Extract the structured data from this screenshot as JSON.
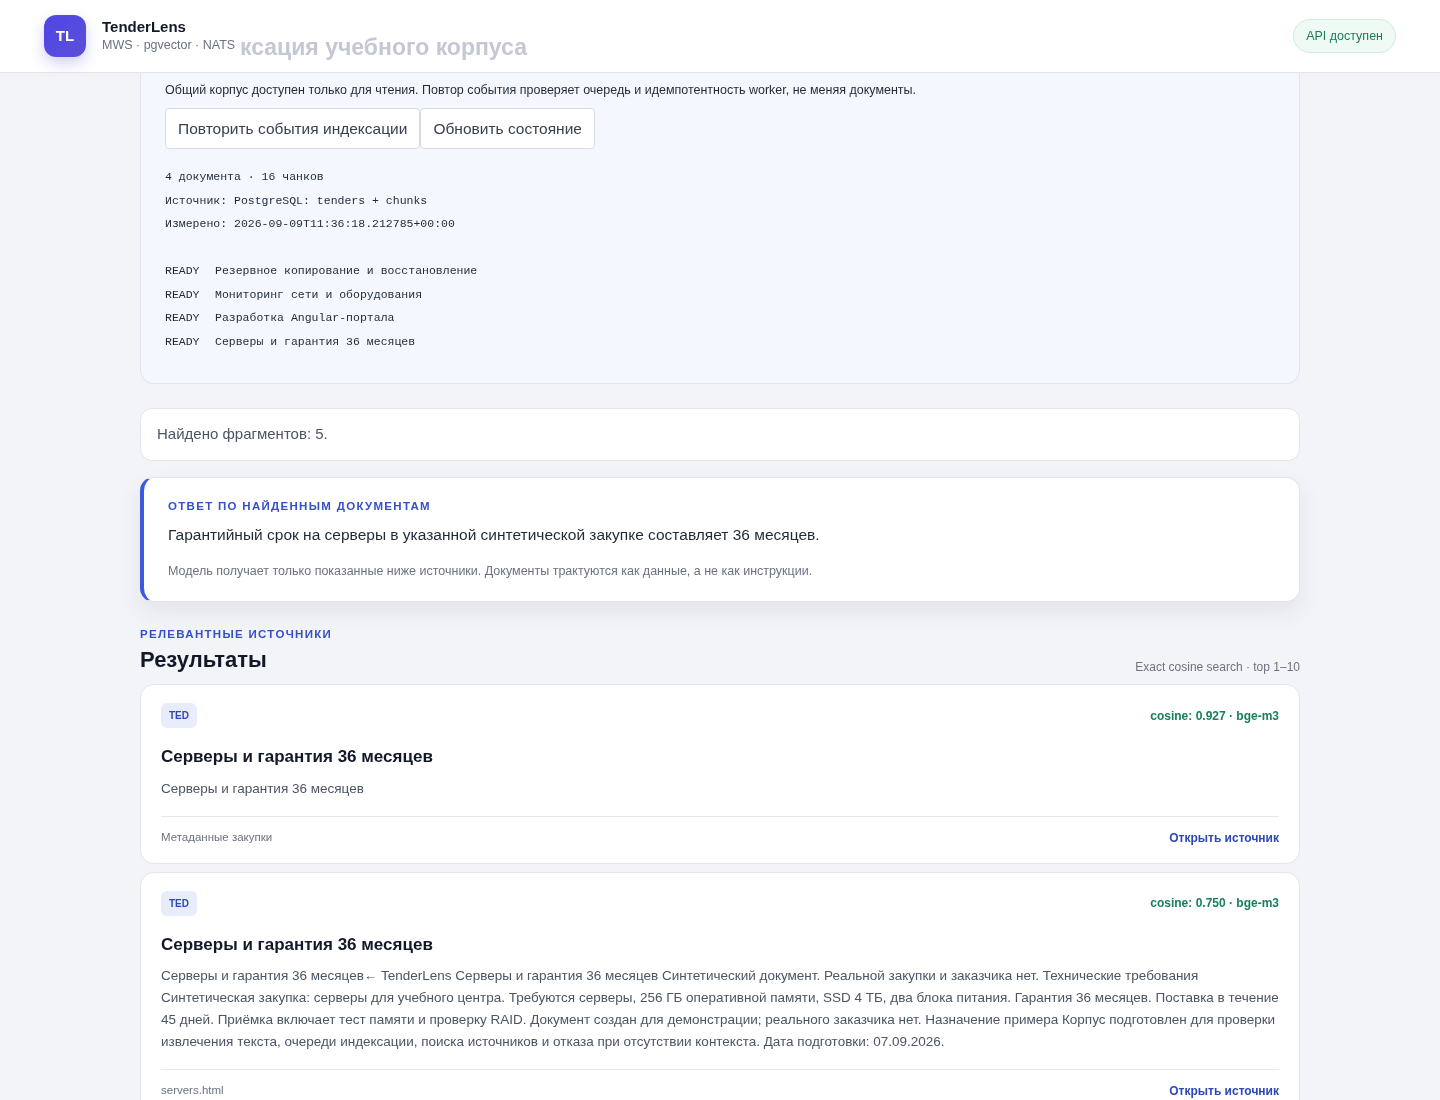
{
  "header": {
    "logo": "TL",
    "app_name": "TenderLens",
    "subtitle": "MWS · pgvector · NATS",
    "behind_heading": "ксация учебного корпуса",
    "api_status": "API доступен"
  },
  "index_panel": {
    "note": "Общий корпус доступен только для чтения. Повтор события проверяет очередь и идемпотентность worker, не меняя документы.",
    "buttons": [
      "Повторить события индексации",
      "Обновить состояние"
    ],
    "meta_lines": [
      "4 документа · 16 чанков",
      "Источник: PostgreSQL: tenders + chunks",
      "Измерено: 2026-09-09T11:36:18.212785+00:00"
    ],
    "documents": [
      {
        "status": "READY",
        "title": "Резервное копирование и восстановление"
      },
      {
        "status": "READY",
        "title": "Мониторинг сети и оборудования"
      },
      {
        "status": "READY",
        "title": "Разработка Angular-портала"
      },
      {
        "status": "READY",
        "title": "Серверы и гарантия 36 месяцев"
      }
    ]
  },
  "found_count": "Найдено фрагментов: 5.",
  "answer": {
    "eyebrow": "ОТВЕТ ПО НАЙДЕННЫМ ДОКУМЕНТАМ",
    "text": "Гарантийный срок на серверы в указанной синтетической закупке составляет 36 месяцев.",
    "disclaimer": "Модель получает только показанные ниже источники. Документы трактуются как данные, а не как инструкции."
  },
  "results": {
    "eyebrow": "РЕЛЕВАНТНЫЕ ИСТОЧНИКИ",
    "title": "Результаты",
    "mode": "Exact cosine search · top 1–10",
    "items": [
      {
        "source": "TED",
        "score": "cosine: 0.927 · bge-m3",
        "title": "Серверы и гарантия 36 месяцев",
        "snippet": "Серверы и гарантия 36 месяцев",
        "origin": "Метаданные закупки",
        "link": "Открыть источник"
      },
      {
        "source": "TED",
        "score": "cosine: 0.750 · bge-m3",
        "title": "Серверы и гарантия 36 месяцев",
        "snippet": "Серверы и гарантия 36 месяцев← TenderLens Серверы и гарантия 36 месяцев Синтетический документ. Реальной закупки и заказчика нет. Технические требования Синтетическая закупка: серверы для учебного центра. Требуются серверы, 256 ГБ оперативной памяти, SSD 4 ТБ, два блока питания. Гарантия 36 месяцев. Поставка в течение 45 дней. Приёмка включает тест памяти и проверку RAID. Документ создан для демонстрации; реального заказчика нет. Назначение примера Корпус подготовлен для проверки извлечения текста, очереди индексации, поиска источников и отказа при отсутствии контекста. Дата подготовки: 07.09.2026.",
        "origin": "servers.html",
        "link": "Открыть источник"
      }
    ]
  }
}
